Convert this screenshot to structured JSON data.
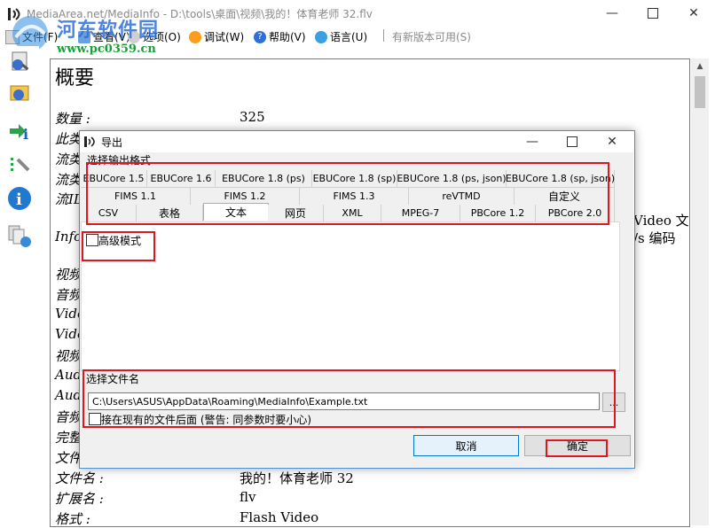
{
  "window": {
    "title": "MediaArea.net/MediaInfo - D:\\tools\\桌面\\视频\\我的！体育老师 32.flv",
    "controls": [
      "minimize-icon",
      "maximize-icon",
      "close-icon"
    ]
  },
  "menubar": {
    "items": [
      {
        "label": "文件(F)",
        "icon": "file-icon"
      },
      {
        "label": "查看(V)",
        "icon": "view-icon"
      },
      {
        "label": "选项(O)",
        "icon": "options-icon"
      },
      {
        "label": "调试(W)",
        "icon": "debug-icon"
      },
      {
        "label": "帮助(V)",
        "icon": "help-icon"
      },
      {
        "label": "语言(U)",
        "icon": "language-icon"
      }
    ],
    "update_label": "有新版本可用(S)"
  },
  "watermark": {
    "text": "河东软件园",
    "url": "www.pc0359.cn"
  },
  "toolbar": {
    "icons": [
      "open-file-icon",
      "open-folder-icon",
      "export-icon",
      "preferences-icon",
      "about-icon",
      "knowledge-base-icon"
    ]
  },
  "content": {
    "heading": "概要",
    "rows": [
      {
        "label": "数量 :",
        "value": "325"
      },
      {
        "label": "此类",
        "value": ""
      },
      {
        "label": "流类",
        "value": ""
      },
      {
        "label": "流类",
        "value": ""
      },
      {
        "label": "流ID",
        "value": ""
      },
      {
        "label": "Infor",
        "value": ""
      },
      {
        "label": "视频",
        "value": ""
      },
      {
        "label": "音频",
        "value": ""
      },
      {
        "label": "Vide",
        "value": ""
      },
      {
        "label": "Vide",
        "value": ""
      },
      {
        "label": "视频",
        "value": ""
      },
      {
        "label": "Audi",
        "value": ""
      },
      {
        "label": "Audi",
        "value": ""
      },
      {
        "label": "音频",
        "value": ""
      },
      {
        "label": "完整",
        "value": ""
      },
      {
        "label": "文件",
        "value": ""
      },
      {
        "label": "文件名 :",
        "value": "我的！体育老师  32"
      },
      {
        "label": "扩展名 :",
        "value": "flv"
      },
      {
        "label": "格式 :",
        "value": "Flash Video"
      }
    ],
    "right_fragment_1": "Video 文",
    "right_fragment_2": "/s 编码"
  },
  "dialog": {
    "title": "导出",
    "format_group_label": "选择输出格式",
    "tab_rows": [
      [
        "EBUCore 1.5",
        "EBUCore 1.6",
        "EBUCore 1.8 (ps)",
        "EBUCore 1.8 (sp)",
        "EBUCore 1.8 (ps, json)",
        "EBUCore 1.8 (sp, json)"
      ],
      [
        "FIMS 1.1",
        "FIMS 1.2",
        "FIMS 1.3",
        "reVTMD",
        "自定义"
      ],
      [
        "CSV",
        "表格",
        "文本",
        "网页",
        "XML",
        "MPEG-7",
        "PBCore 1.2",
        "PBCore 2.0"
      ]
    ],
    "active_tab": "文本",
    "advanced_mode_label": "高级模式",
    "advanced_mode_checked": false,
    "file_group_label": "选择文件名",
    "file_path": "C:\\Users\\ASUS\\AppData\\Roaming\\MediaInfo\\Example.txt",
    "browse_label": "...",
    "append_label": "接在现有的文件后面 (警告: 同参数时要小心)",
    "append_checked": false,
    "cancel_label": "取消",
    "ok_label": "确定"
  },
  "colors": {
    "highlight": "#e0161e",
    "dialog_border": "#4a8ad4",
    "default_button_border": "#0078d7"
  }
}
